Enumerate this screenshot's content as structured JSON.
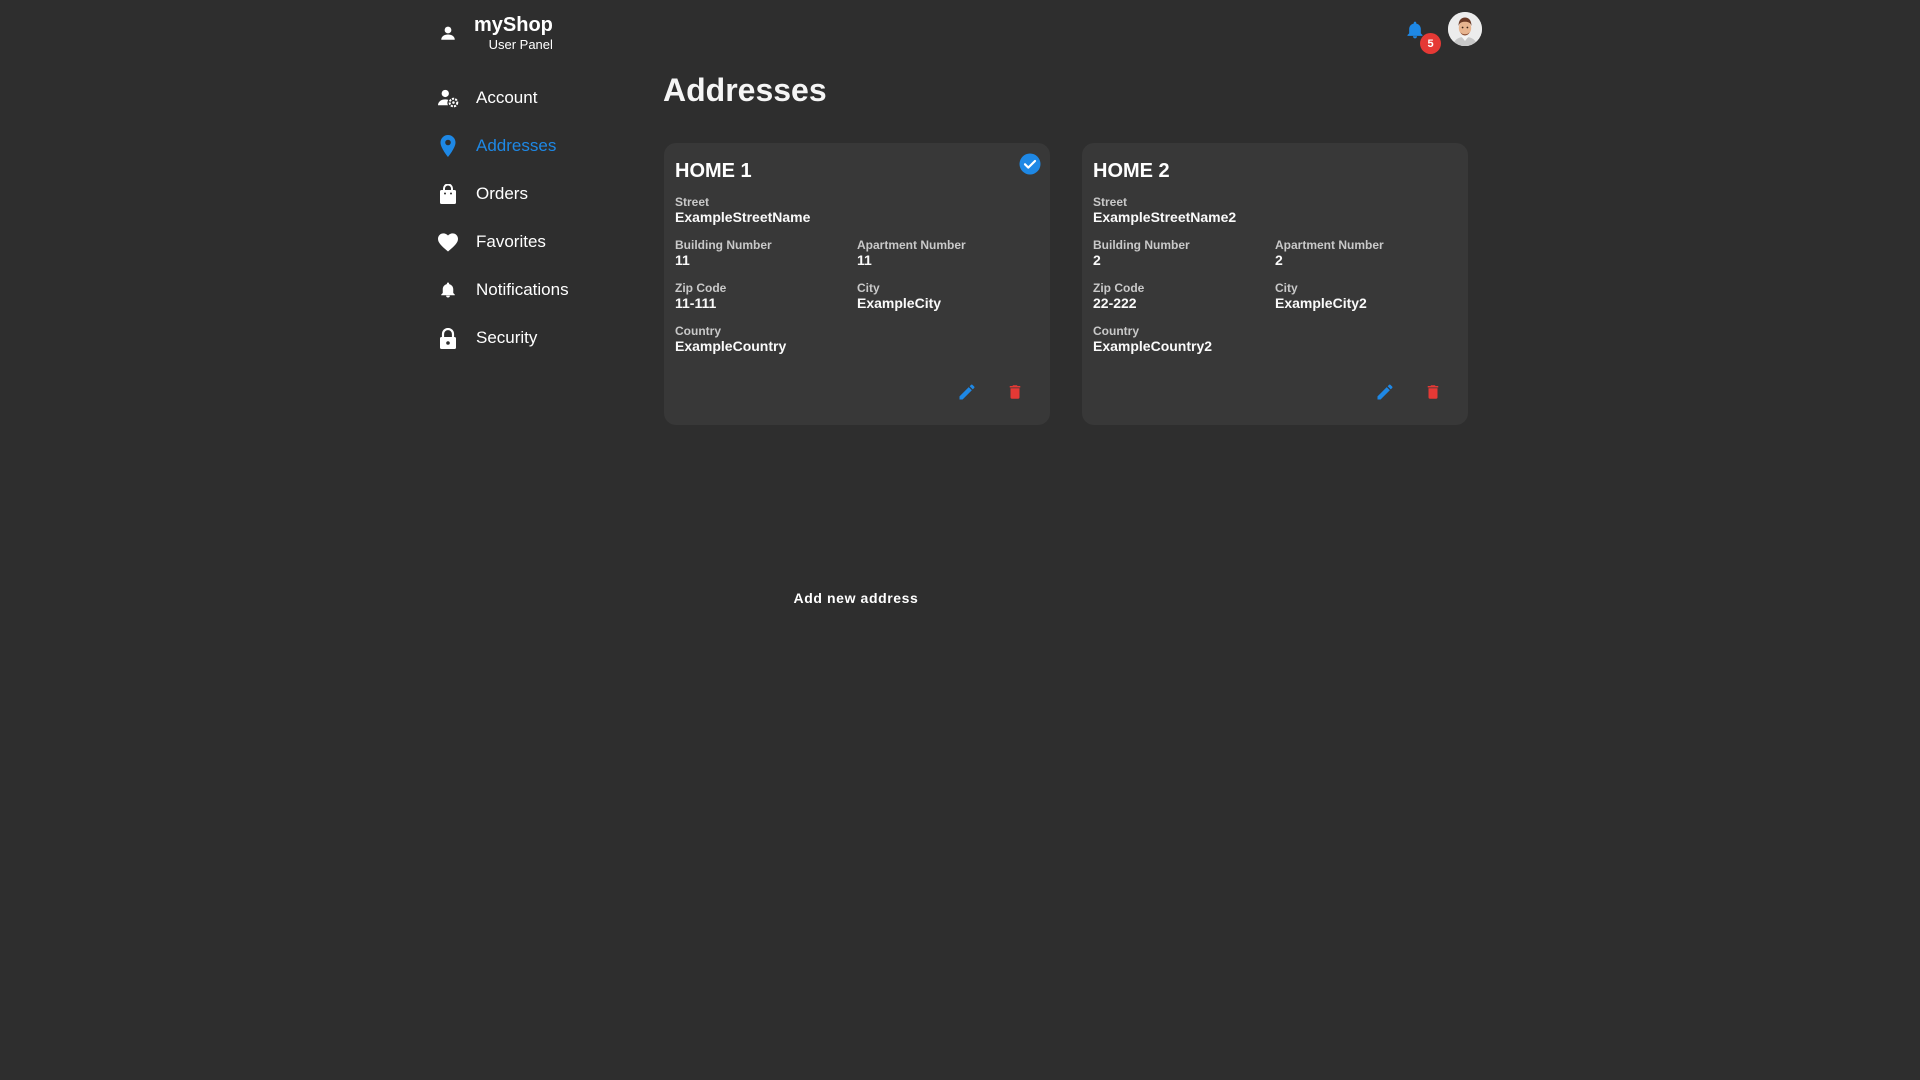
{
  "brand": {
    "title": "myShop",
    "subtitle": "User Panel",
    "icon": "person-icon"
  },
  "header": {
    "notification_count": "5",
    "bell_icon": "bell-icon",
    "avatar_icon": "avatar"
  },
  "colors": {
    "accent": "#1e88e5",
    "danger": "#e53935",
    "background": "#2e2e2e",
    "card": "#383838"
  },
  "sidebar": {
    "items": [
      {
        "label": "Account",
        "icon": "account-settings-icon",
        "active": false
      },
      {
        "label": "Addresses",
        "icon": "map-pin-icon",
        "active": true
      },
      {
        "label": "Orders",
        "icon": "shopping-bag-icon",
        "active": false
      },
      {
        "label": "Favorites",
        "icon": "heart-icon",
        "active": false
      },
      {
        "label": "Notifications",
        "icon": "bell-icon",
        "active": false
      },
      {
        "label": "Security",
        "icon": "lock-icon",
        "active": false
      }
    ]
  },
  "main": {
    "title": "Addresses",
    "add_button": "Add new address",
    "labels": {
      "street": "Street",
      "building": "Building Number",
      "apartment": "Apartment Number",
      "zip": "Zip Code",
      "city": "City",
      "country": "Country"
    },
    "addresses": [
      {
        "name": "HOME 1",
        "default": true,
        "street": "ExampleStreetName",
        "building": "11",
        "apartment": "11",
        "zip": "11-111",
        "city": "ExampleCity",
        "country": "ExampleCountry"
      },
      {
        "name": "HOME 2",
        "default": false,
        "street": "ExampleStreetName2",
        "building": "2",
        "apartment": "2",
        "zip": "22-222",
        "city": "ExampleCity2",
        "country": "ExampleCountry2"
      }
    ]
  }
}
